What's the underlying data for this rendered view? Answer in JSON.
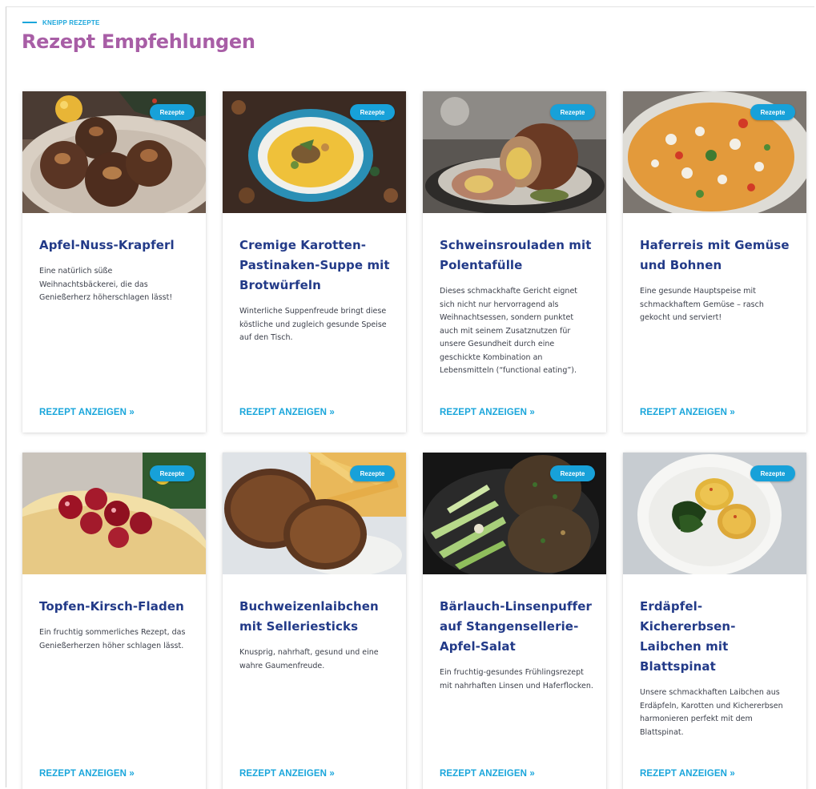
{
  "header": {
    "eyebrow": "KNEIPP REZEPTE",
    "title": "Rezept Empfehlungen"
  },
  "colors": {
    "accent": "#1aa6db",
    "title": "#a85ea6",
    "card_title": "#223a88"
  },
  "cards": [
    {
      "badge": "Rezepte",
      "title": "Apfel-Nuss-Krapferl",
      "description": "Eine natürlich süße Weihnachtsbäckerei, die das Genießerherz höherschlagen lässt!",
      "link": "REZEPT ANZEIGEN »"
    },
    {
      "badge": "Rezepte",
      "title": "Cremige Karotten-Pastinaken-Suppe mit Brotwürfeln",
      "description": "Winterliche Suppenfreude bringt diese köstliche und zugleich gesunde Speise auf den Tisch.",
      "link": "REZEPT ANZEIGEN »"
    },
    {
      "badge": "Rezepte",
      "title": "Schweinsrouladen mit Polentafülle",
      "description": "Dieses schmackhafte Gericht eignet sich nicht nur hervorragend als Weihnachtsessen, sondern punktet auch mit seinem Zusatznutzen für unsere Gesundheit durch eine geschickte Kombination an Lebensmitteln (“functional eating”).",
      "link": "REZEPT ANZEIGEN »"
    },
    {
      "badge": "Rezepte",
      "title": "Haferreis mit Gemüse und Bohnen",
      "description": "Eine gesunde Hauptspeise mit schmackhaftem Gemüse – rasch gekocht und serviert!",
      "link": "REZEPT ANZEIGEN »"
    },
    {
      "badge": "Rezepte",
      "title": "Topfen-Kirsch-Fladen",
      "description": "Ein fruchtig sommerliches Rezept, das Genießerherzen höher schlagen lässt.",
      "link": "REZEPT ANZEIGEN »"
    },
    {
      "badge": "Rezepte",
      "title": "Buchweizenlaibchen mit Selleriesticks",
      "description": "Knusprig, nahrhaft, gesund und eine wahre Gaumenfreude.",
      "link": "REZEPT ANZEIGEN »"
    },
    {
      "badge": "Rezepte",
      "title": "Bärlauch-Linsenpuffer auf Stangensellerie-Apfel-Salat",
      "description": "Ein fruchtig-gesundes Frühlingsrezept mit nahrhaften Linsen und Haferflocken.",
      "link": "REZEPT ANZEIGEN »"
    },
    {
      "badge": "Rezepte",
      "title": "Erdäpfel-Kichererbsen-Laibchen mit Blattspinat",
      "description": "Unsere schmackhaften Laibchen aus Erdäpfeln, Karotten und Kichererbsen harmonieren perfekt mit dem Blattspinat.",
      "link": "REZEPT ANZEIGEN »"
    }
  ]
}
